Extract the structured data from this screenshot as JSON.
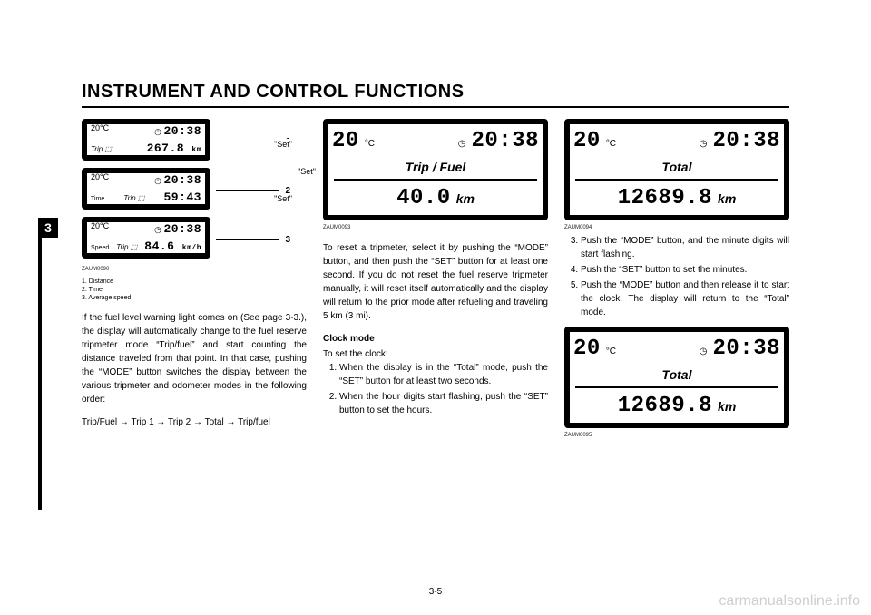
{
  "page": {
    "section_tab": "3",
    "heading": "INSTRUMENT AND CONTROL FUNCTIONS",
    "page_number": "3-5",
    "watermark": "carmanualsonline.info"
  },
  "col1": {
    "fig_id": "ZAUM0090",
    "caption": [
      "1. Distance",
      "2. Time",
      "3. Average speed"
    ],
    "para": "If the fuel level warning light comes on (See page 3-3.), the display will automatically change to the fuel reserve tripmeter mode “Trip/fuel” and start counting the distance traveled from that point. In that case, pushing the “MODE” button switches the display between the various tripmeter and odometer modes in the following order:",
    "sequence": "Trip/Fuel → Trip 1 → Trip 2 → Total → Trip/fuel",
    "labels": {
      "set": "\"Set\"",
      "ind1": "1",
      "ind2": "2",
      "ind3": "3"
    },
    "lcd_mini": {
      "temp": "20°C",
      "clock_icon": "◷",
      "time": "20:38",
      "mode_label": "Trip",
      "segment_icon": "⬚",
      "panel1_value": "267.8",
      "panel1_unit": "km",
      "panel2_label": "Time",
      "panel2_value": "59:43",
      "panel3_label": "Speed",
      "panel3_value": "84.6",
      "panel3_unit": "km/h"
    }
  },
  "col2": {
    "fig_id": "ZAUM0093",
    "lcd": {
      "temp": "20",
      "temp_unit": "°C",
      "clock_icon": "◷",
      "time": "20:38",
      "mode_label": "Trip / Fuel",
      "value": "40.0",
      "unit": "km"
    },
    "para1": "To reset a tripmeter, select it by pushing the “MODE” button, and then push the “SET” button for at least one second. If you do not reset the fuel reserve tripmeter manually, it will reset itself automatically and the display will return to the prior mode after refueling and traveling 5 km (3 mi).",
    "h4": "Clock mode",
    "lead": "To set the clock:",
    "steps": [
      "When the display is in the “Total” mode, push the “SET” button for at least two seconds.",
      "When the hour digits start flashing, push the “SET” button to set the hours."
    ]
  },
  "col3": {
    "fig_id1": "ZAUM0094",
    "fig_id2": "ZAUM0095",
    "lcd": {
      "temp": "20",
      "temp_unit": "°C",
      "clock_icon": "◷",
      "time": "20:38",
      "mode_label": "Total",
      "value": "12689.8",
      "unit": "km"
    },
    "steps": [
      "Push the “MODE” button, and the minute digits will start flashing.",
      "Push the “SET” button to set the minutes.",
      "Push the “MODE” button and then release it to start the clock. The display will return to the “Total” mode."
    ]
  }
}
